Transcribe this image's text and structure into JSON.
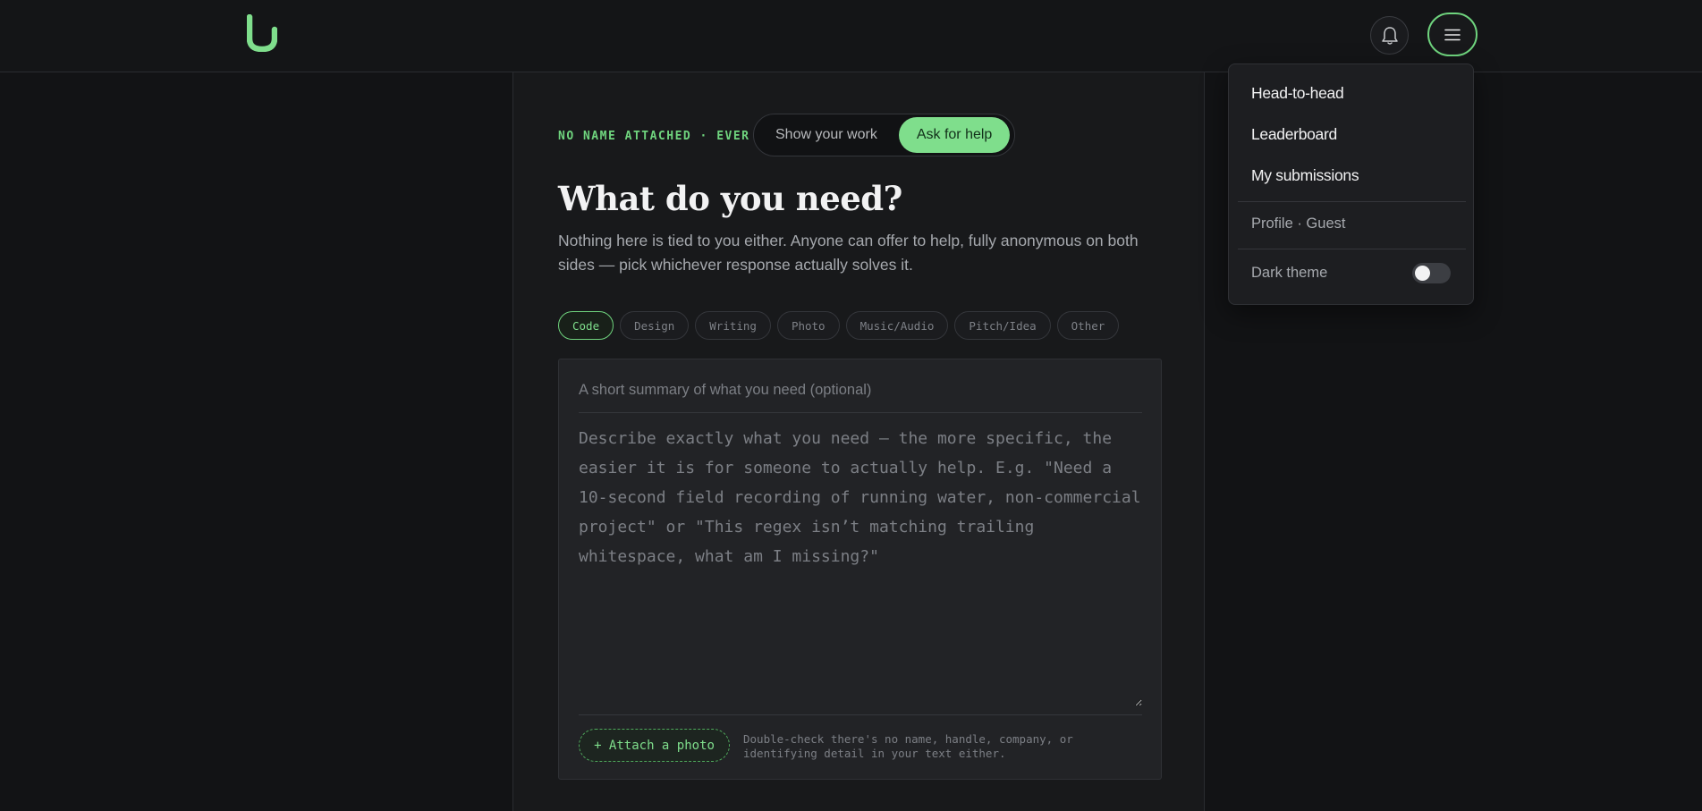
{
  "header": {
    "logo_icon": "u-logo-icon",
    "bell_icon": "bell-icon",
    "menu_icon": "hamburger-icon",
    "accent_color": "#6fd47e"
  },
  "hero": {
    "eyebrow": "NO NAME ATTACHED · EVER",
    "modes": [
      {
        "label": "Show your work",
        "active": false
      },
      {
        "label": "Ask for help",
        "active": true
      }
    ],
    "title": "What do you need?",
    "subtitle": "Nothing here is tied to you either. Anyone can offer to help, fully anonymous on both sides — pick whichever response actually solves it."
  },
  "categories": [
    {
      "label": "Code",
      "active": true
    },
    {
      "label": "Design",
      "active": false
    },
    {
      "label": "Writing",
      "active": false
    },
    {
      "label": "Photo",
      "active": false
    },
    {
      "label": "Music/Audio",
      "active": false
    },
    {
      "label": "Pitch/Idea",
      "active": false
    },
    {
      "label": "Other",
      "active": false
    }
  ],
  "form": {
    "summary_placeholder": "A short summary of what you need (optional)",
    "summary_value": "",
    "details_placeholder": "Describe exactly what you need — the more specific, the easier it is for someone to actually help. E.g. \"Need a 10-second field recording of running water, non-commercial project\" or \"This regex isn’t matching trailing whitespace, what am I missing?\"",
    "details_value": "",
    "attach_label": "+ Attach a photo",
    "attach_hint": "Double-check there's no name, handle, company, or identifying detail in your text either."
  },
  "menu": {
    "items": [
      "Head-to-head",
      "Leaderboard",
      "My submissions"
    ],
    "profile": "Profile · Guest",
    "theme_label": "Dark theme",
    "theme_enabled": false
  }
}
